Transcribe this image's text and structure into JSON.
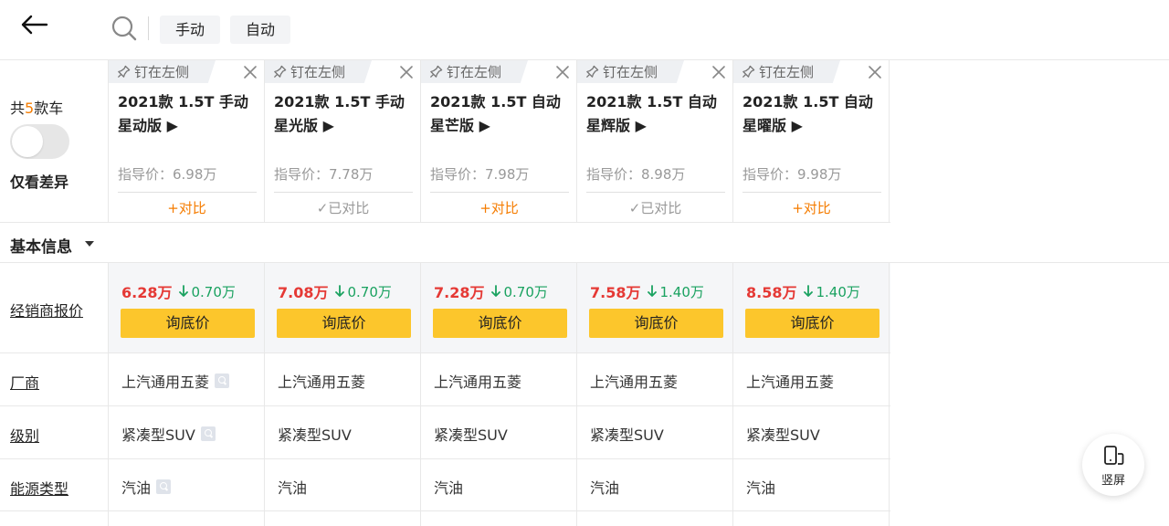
{
  "filters": [
    "手动",
    "自动"
  ],
  "sidebar": {
    "count_prefix": "共",
    "count_num": "5",
    "count_suffix": "款车",
    "diff_label": "仅看差异"
  },
  "pin_label": "钉在左侧",
  "cars": [
    {
      "name": "2021款 1.5T 手动星动版 ▶",
      "guide_price": "指导价：6.98万",
      "compare": "+对比",
      "compared": false
    },
    {
      "name": "2021款 1.5T 手动星光版 ▶",
      "guide_price": "指导价：7.78万",
      "compare": "✓已对比",
      "compared": true
    },
    {
      "name": "2021款 1.5T 自动星芒版 ▶",
      "guide_price": "指导价：7.98万",
      "compare": "+对比",
      "compared": false
    },
    {
      "name": "2021款 1.5T 自动星辉版 ▶",
      "guide_price": "指导价：8.98万",
      "compare": "✓已对比",
      "compared": true
    },
    {
      "name": "2021款 1.5T 自动星曜版 ▶",
      "guide_price": "指导价：9.98万",
      "compare": "+对比",
      "compared": false
    }
  ],
  "section": {
    "title": "基本信息"
  },
  "dealer_row": {
    "label": "经销商报价",
    "button_label": "询底价",
    "prices": [
      {
        "value": "6.28万",
        "drop": "0.70万"
      },
      {
        "value": "7.08万",
        "drop": "0.70万"
      },
      {
        "value": "7.28万",
        "drop": "0.70万"
      },
      {
        "value": "7.58万",
        "drop": "1.40万"
      },
      {
        "value": "8.58万",
        "drop": "1.40万"
      }
    ]
  },
  "rows": {
    "maker": {
      "label": "厂商",
      "values": [
        "上汽通用五菱",
        "上汽通用五菱",
        "上汽通用五菱",
        "上汽通用五菱",
        "上汽通用五菱"
      ]
    },
    "level": {
      "label": "级别",
      "values": [
        "紧凑型SUV",
        "紧凑型SUV",
        "紧凑型SUV",
        "紧凑型SUV",
        "紧凑型SUV"
      ]
    },
    "energy": {
      "label": "能源类型",
      "values": [
        "汽油",
        "汽油",
        "汽油",
        "汽油",
        "汽油"
      ]
    }
  },
  "fab": {
    "label": "竖屏"
  },
  "colors": {
    "accent_orange": "#f57c00",
    "price_red": "#e53935",
    "drop_green": "#1aa260",
    "button_yellow": "#fcc62c"
  },
  "icons": [
    "back-arrow-icon",
    "search-icon",
    "pin-icon",
    "close-icon",
    "down-arrow-icon",
    "rotate-phone-icon"
  ]
}
